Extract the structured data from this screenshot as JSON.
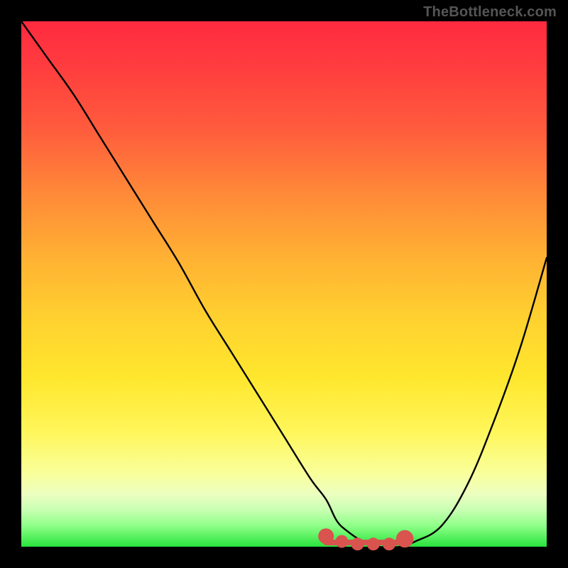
{
  "watermark": "TheBottleneck.com",
  "colors": {
    "frame": "#000000",
    "gradient_top": "#ff2a3f",
    "gradient_mid": "#ffe72e",
    "gradient_bottom": "#28e43c",
    "curve": "#000000",
    "marker": "#d9534f"
  },
  "chart_data": {
    "type": "line",
    "title": "",
    "xlabel": "",
    "ylabel": "",
    "xlim": [
      0,
      100
    ],
    "ylim": [
      0,
      100
    ],
    "grid": false,
    "legend": false,
    "series": [
      {
        "name": "bottleneck-curve",
        "x": [
          0,
          5,
          10,
          15,
          20,
          25,
          30,
          35,
          40,
          45,
          50,
          55,
          58,
          60,
          62,
          65,
          68,
          70,
          72,
          75,
          80,
          85,
          90,
          95,
          100
        ],
        "y": [
          100,
          93,
          86,
          78,
          70,
          62,
          54,
          45,
          37,
          29,
          21,
          13,
          9,
          5,
          3,
          1,
          0,
          0,
          0,
          1,
          4,
          12,
          24,
          38,
          55
        ]
      }
    ],
    "markers": [
      {
        "name": "min-band-start",
        "x": 58,
        "y": 2,
        "r": 1.2
      },
      {
        "name": "min-band-a",
        "x": 61,
        "y": 1,
        "r": 0.9
      },
      {
        "name": "min-band-b",
        "x": 64,
        "y": 0.5,
        "r": 0.9
      },
      {
        "name": "min-band-c",
        "x": 67,
        "y": 0.5,
        "r": 0.9
      },
      {
        "name": "min-band-d",
        "x": 70,
        "y": 0.5,
        "r": 0.9
      },
      {
        "name": "min-band-end",
        "x": 73,
        "y": 1.5,
        "r": 1.4
      }
    ],
    "min_band": {
      "x_start": 58,
      "x_end": 73,
      "y": 0.8
    }
  }
}
